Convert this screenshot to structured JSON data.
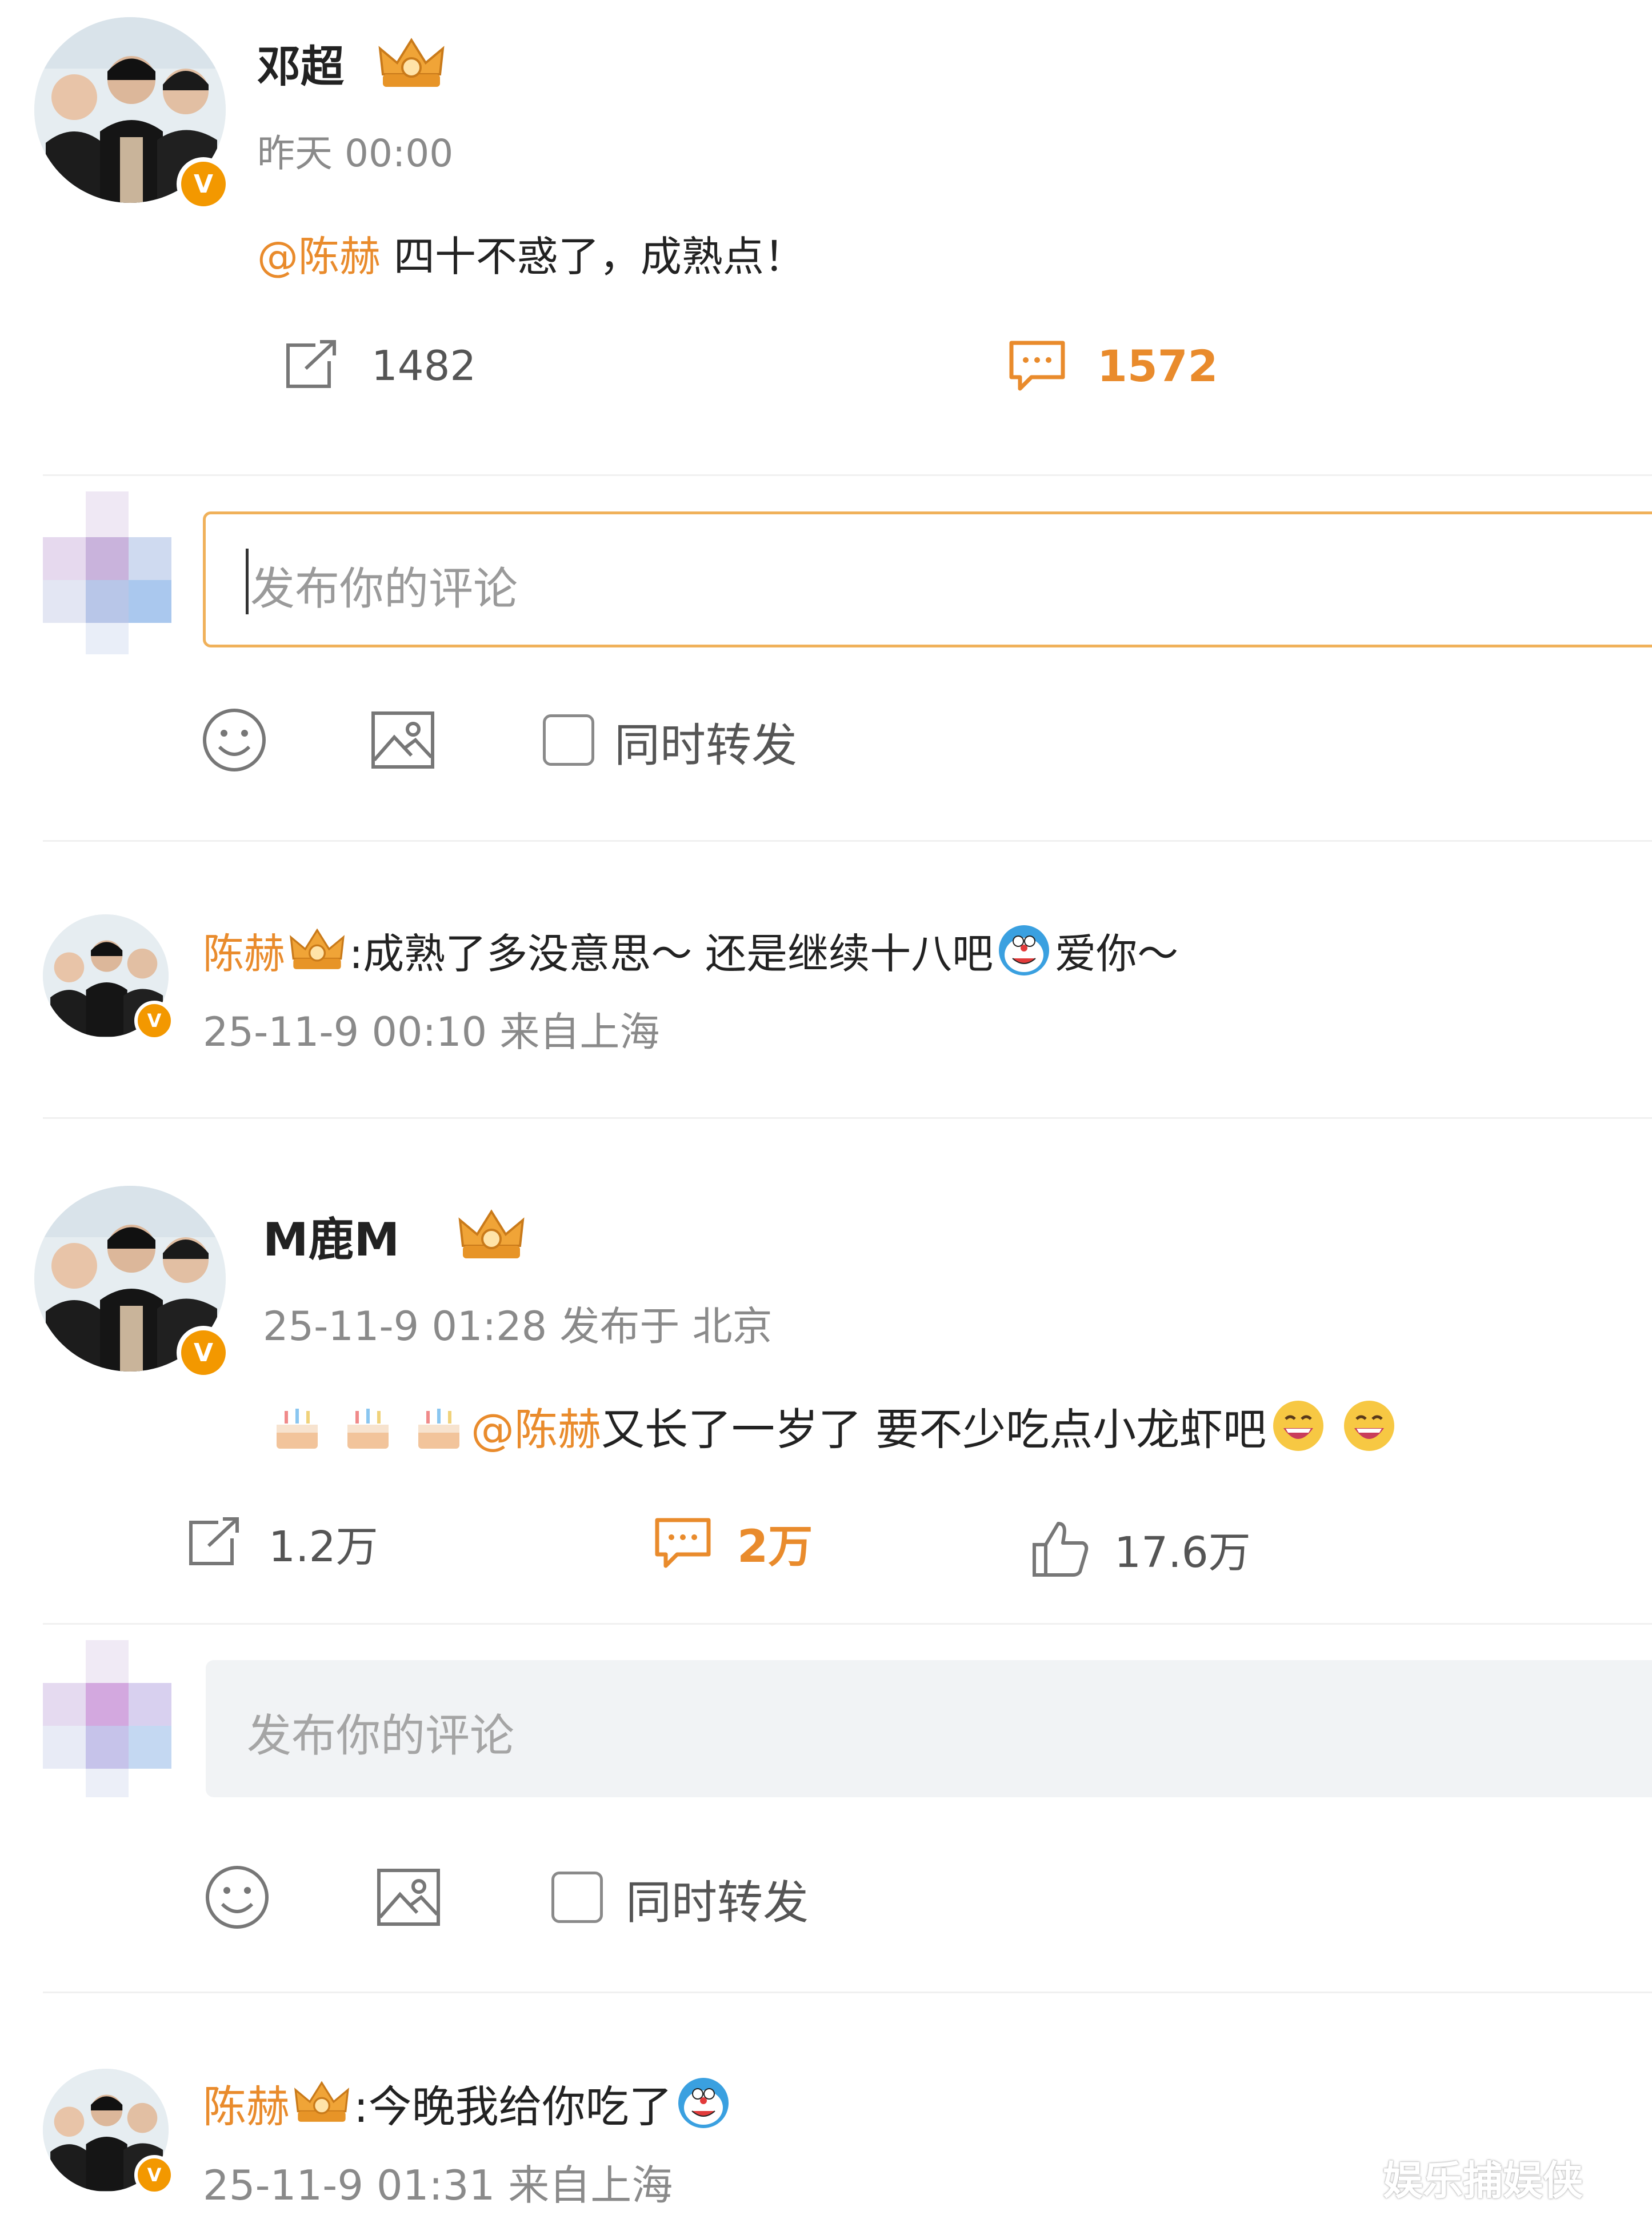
{
  "post": {
    "author": "邓超",
    "time": "昨天 00:00",
    "mention": "@陈赫",
    "text": " 四十不惑了，成熟点！",
    "repost_count": "1482",
    "comment_count": "1572"
  },
  "composer1": {
    "placeholder": "发布你的评论",
    "repost_label": "同时转发"
  },
  "reply1": {
    "author": "陈赫",
    "text_a": ":成熟了多没意思～ 还是继续十八吧",
    "text_b": " 爱你～",
    "meta": "25-11-9 00:10 来自上海"
  },
  "comment2": {
    "author": "M鹿M",
    "meta": "25-11-9 01:28 发布于 北京",
    "mention": "@陈赫",
    "text": " 又长了一岁了 要不少吃点小龙虾吧",
    "repost_count": "1.2万",
    "comment_count": "2万",
    "like_count": "17.6万"
  },
  "composer2": {
    "placeholder": "发布你的评论",
    "repost_label": "同时转发"
  },
  "reply2": {
    "author": "陈赫",
    "text": ":今晚我给你吃了",
    "meta": "25-11-9 01:31 来自上海"
  },
  "watermark": "娱乐捕娱侠",
  "colors": {
    "accent": "#e98b2c",
    "badge": "#f39800",
    "grey_text": "#8a8a8a"
  }
}
